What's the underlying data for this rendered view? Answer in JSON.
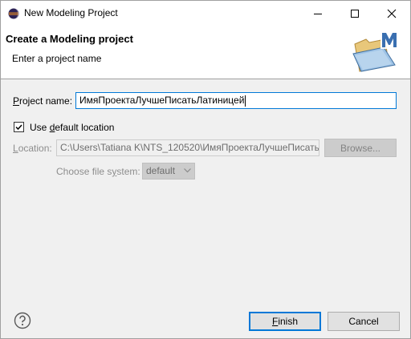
{
  "window": {
    "title": "New Modeling Project"
  },
  "header": {
    "title": "Create a Modeling project",
    "subtitle": "Enter a project name"
  },
  "form": {
    "project_name_label_u": "P",
    "project_name_label_rest": "roject name:",
    "project_name_value": "ИмяПроектаЛучшеПисатьЛатиницей",
    "use_default_checked": true,
    "use_default_prefix": "Use ",
    "use_default_u": "d",
    "use_default_rest": "efault location",
    "location_label_u": "L",
    "location_label_rest": "ocation:",
    "location_value": "C:\\Users\\Tatiana K\\NTS_120520\\ИмяПроектаЛучшеПисать.",
    "browse_label": "Browse...",
    "file_system_label_prefix": "Choose file s",
    "file_system_label_u": "y",
    "file_system_label_rest": "stem:",
    "file_system_value": "default"
  },
  "footer": {
    "finish_u": "F",
    "finish_rest": "inish",
    "cancel_label": "Cancel"
  },
  "colors": {
    "focus_border": "#0078d7",
    "disabled_text": "#8d8d8d",
    "dialog_bg": "#f0f0f0"
  },
  "icons": {
    "title": "eclipse-icon",
    "header": "modeling-folder-icon",
    "help": "help-icon"
  }
}
